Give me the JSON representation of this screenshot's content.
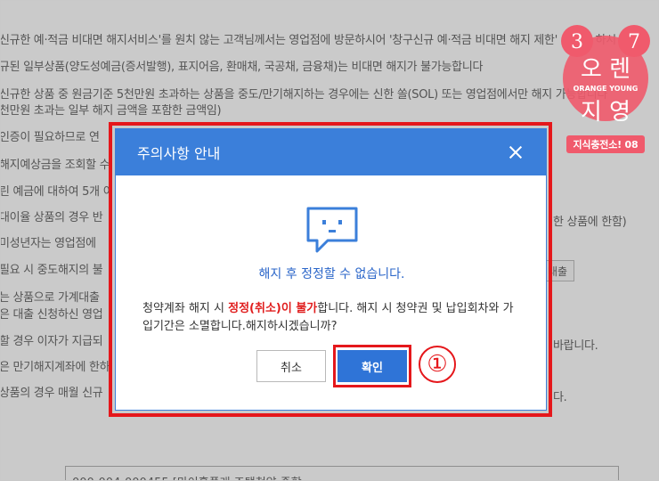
{
  "background": {
    "lines": [
      "신규한 예·적금 비대면 해지서비스'를 원치 않는 고객님께서는 영업점에 방문하시어 '창구신규 예·적금 비대면 해지 제한' 요청을 하시",
      "규된 일부상품(양도성예금(증서발행), 표지어음, 환매채, 국공채, 금융채)는 비대면 해지가 불가능합니다",
      "신규한 상품 중 원금기준 5천만원 초과하는 상품을 중도/만기해지하는 경우에는 신한 쏠(SOL) 또는 영업점에서만 해지 가능합니다",
      "천만원 초과는 일부 해지 금액을 포함한 금액임)",
      "인증이 필요하므로 연",
      "해지예상금을 조회할 수",
      "린 예금에 대하여 5개 이",
      "대이율 상품의 경우 반",
      " 미성년자는 영업점에",
      "필요 시 중도해지의 불",
      "는 상품으로 가계대출",
      "은 대출 신청하신 영업",
      "할 경우 이자가 지급되",
      "은 만기해지계좌에 한하",
      "상품의 경우 매월 신규"
    ],
    "right_texts": [
      "한 상품에 한함)",
      "바랍니다.",
      "다."
    ],
    "right_button": "대출",
    "bottom_text": "000-004-000455 [마이홈플래 조택청약 종합..."
  },
  "logo": {
    "number_left": "3",
    "number_right": "7",
    "text_top": "오 렌",
    "text_middle": "ORANGE YOUNG",
    "text_bottom": "지 영",
    "badge": "지식충전소! 08",
    "color": "#f05a6c"
  },
  "modal": {
    "title": "주의사항 안내",
    "icon": "chat-bubble-face-icon",
    "headline": "해지 후 정정할 수 없습니다.",
    "body_prefix": "청약계좌 해지 시 ",
    "body_warning": "정정(취소)이 불가",
    "body_suffix": "합니다. 해지 시 청약권 및 납입회차와 가입기간은 소멸합니다.해지하시겠습니까?",
    "cancel_label": "취소",
    "confirm_label": "확인",
    "accent_color": "#3b7fda",
    "highlight_color": "#e5171b"
  },
  "annotation": {
    "step_marker": "①"
  }
}
